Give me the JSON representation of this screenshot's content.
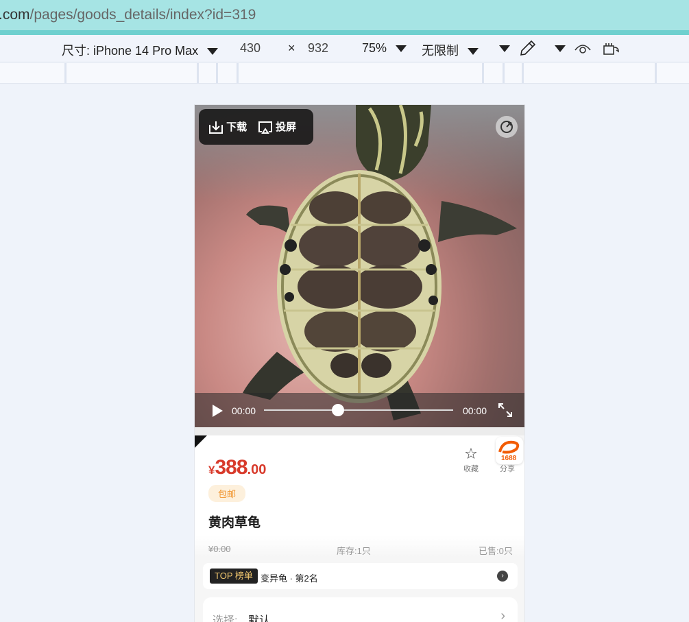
{
  "browser": {
    "url_host": ".com",
    "url_path": "/pages/goods_details/index?id=319"
  },
  "devtools": {
    "device_label": "尺寸: iPhone 14 Pro Max",
    "width": "430",
    "times": "×",
    "height": "932",
    "zoom": "75%",
    "throttle": "无限制"
  },
  "video": {
    "download_label": "下载",
    "cast_label": "投屏",
    "current_time": "00:00",
    "duration": "00:00",
    "progress": 0.39
  },
  "product": {
    "currency": "¥",
    "price_int": "388",
    "price_dec": ".00",
    "fav_label": "收藏",
    "share_label": "分享",
    "logo_text": "1688",
    "tag": "包邮",
    "title": "黄肉草龟",
    "orig_price": "¥0.00",
    "stock": "库存:1只",
    "sold": "已售:0只"
  },
  "rank": {
    "badge_top": "TOP",
    "badge_label": "榜单",
    "text": "变异龟 · 第2名"
  },
  "select": {
    "label": "选择:",
    "value": "默认"
  }
}
